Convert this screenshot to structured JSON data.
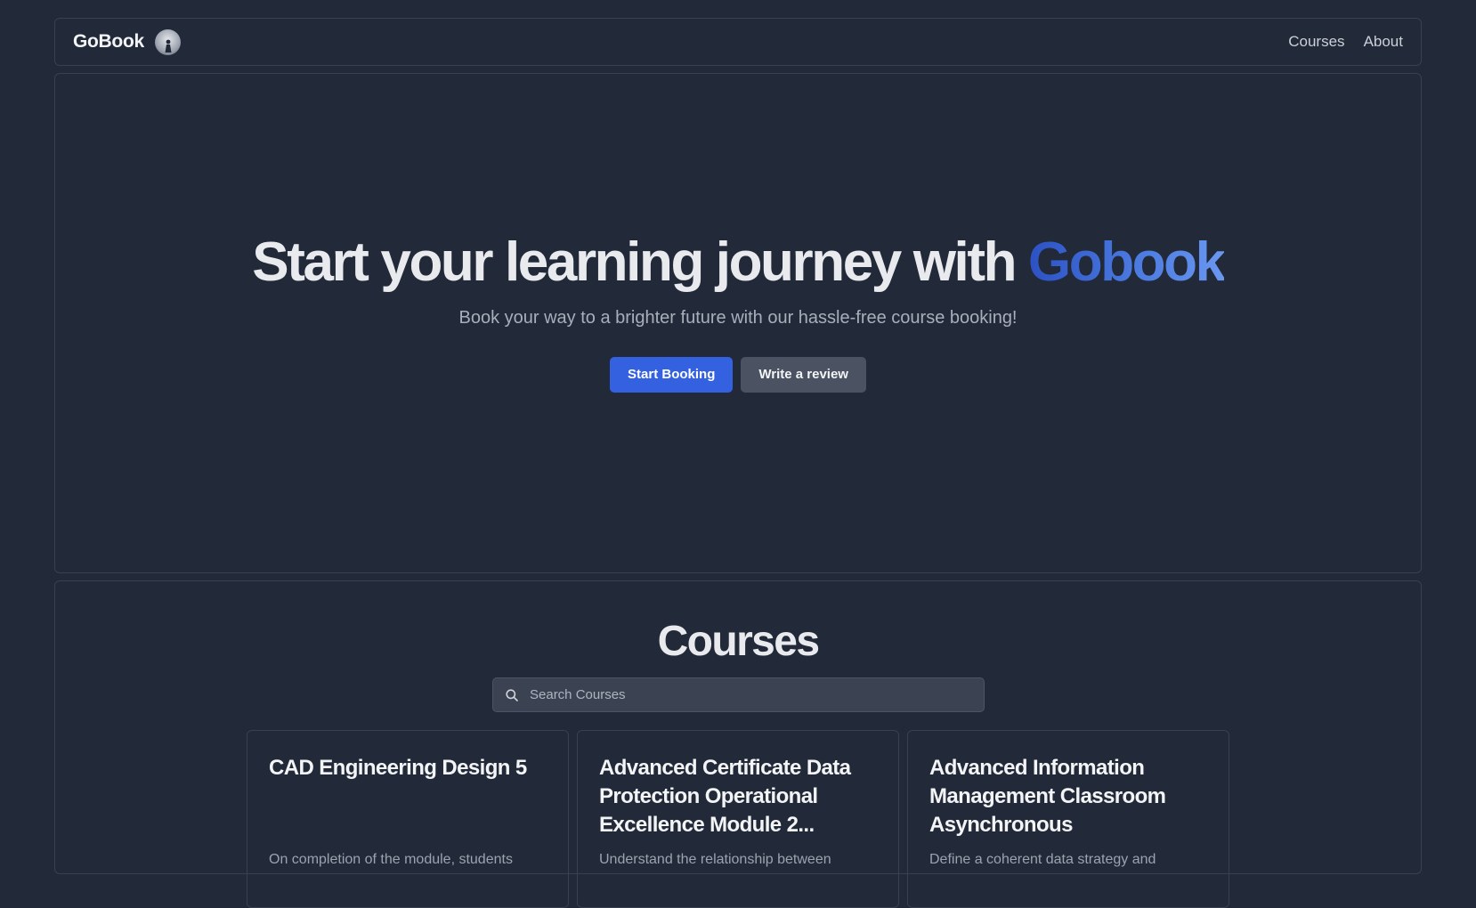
{
  "nav": {
    "brand": "GoBook",
    "links": [
      "Courses",
      "About"
    ]
  },
  "hero": {
    "title_main": "Start your learning journey with ",
    "title_accent": "Gobook",
    "subtitle": "Book your way to a brighter future with our hassle-free course booking!",
    "primary_button": "Start Booking",
    "secondary_button": "Write a review"
  },
  "courses": {
    "title": "Courses",
    "search_placeholder": "Search Courses",
    "items": [
      {
        "title": "CAD Engineering Design 5",
        "description": "On completion of the module, students"
      },
      {
        "title": "Advanced Certificate Data Protection Operational Excellence Module 2...",
        "description": "Understand the relationship between"
      },
      {
        "title": "Advanced Information Management Classroom Asynchronous",
        "description": "Define a coherent data strategy and"
      }
    ]
  },
  "colors": {
    "background": "#222938",
    "accent": "#3461e0",
    "secondary": "#4b5262"
  },
  "icons": {
    "search": "search-icon",
    "avatar": "avatar"
  }
}
